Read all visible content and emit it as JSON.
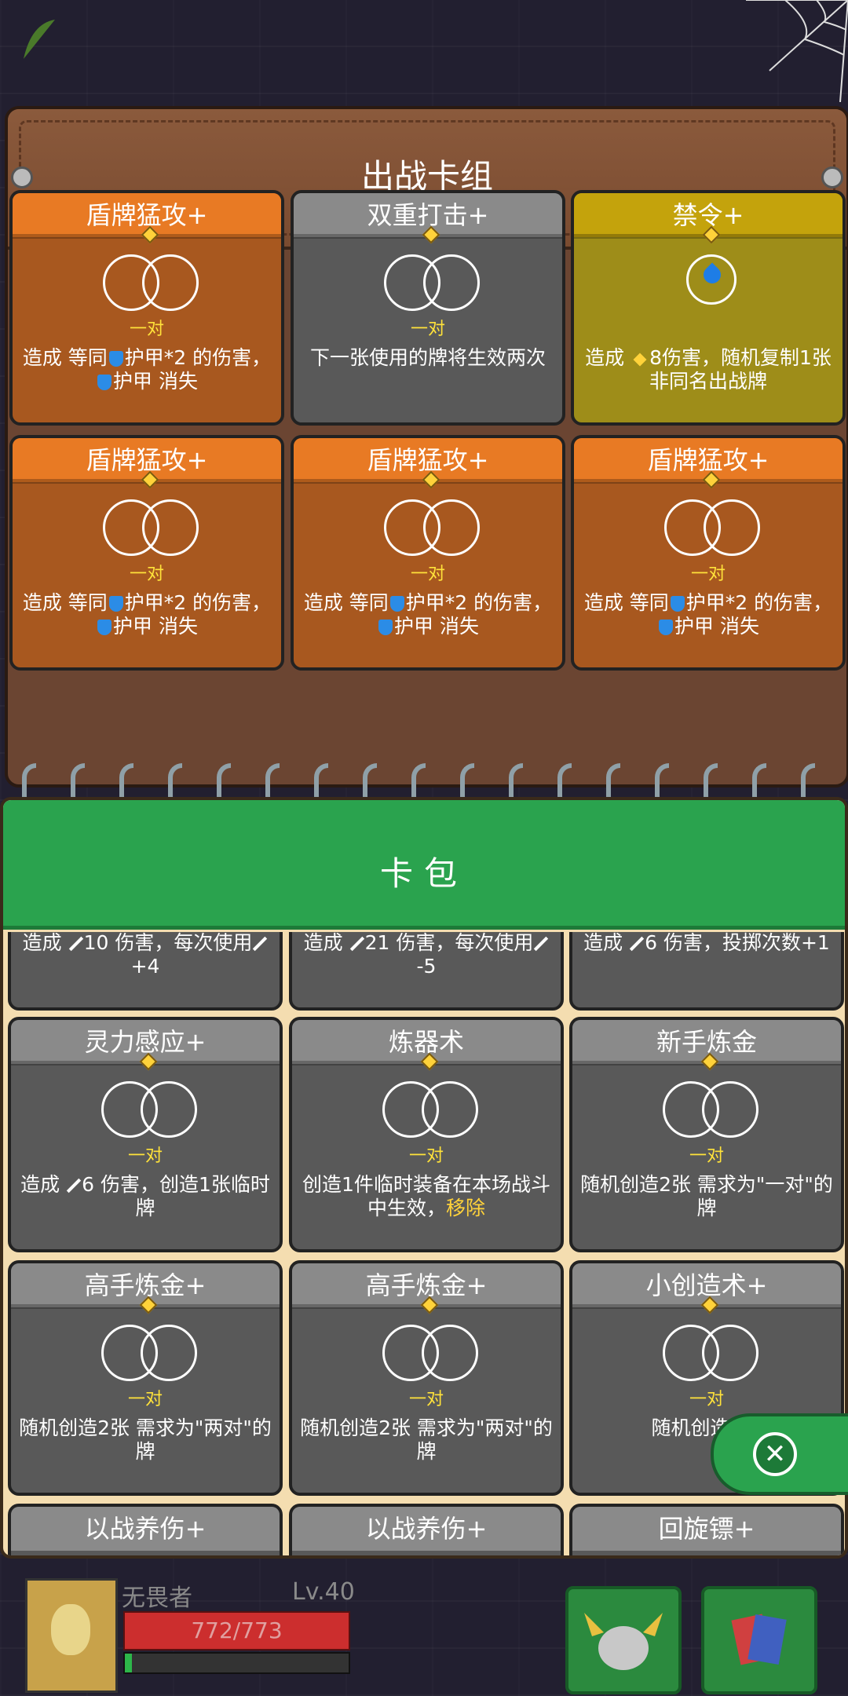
{
  "deck": {
    "title": "出战卡组",
    "cards": [
      {
        "name": "盾牌猛攻+",
        "theme": "orange",
        "icon": "rings",
        "pair": "一对",
        "desc": [
          "造成 等同",
          "shield",
          "护甲*2 的伤害，",
          "shield",
          "护甲 消失"
        ]
      },
      {
        "name": "双重打击+",
        "theme": "gray",
        "icon": "rings",
        "pair": "一对",
        "desc": [
          "下一张使用的牌将生效两次"
        ]
      },
      {
        "name": "禁令+",
        "theme": "olive",
        "icon": "drop",
        "pair": "",
        "desc": [
          "造成 ",
          "dia",
          "8",
          "伤害，随机复制1张非同名出战牌"
        ]
      },
      {
        "name": "盾牌猛攻+",
        "theme": "orange",
        "icon": "rings",
        "pair": "一对",
        "desc": [
          "造成 等同",
          "shield",
          "护甲*2 的伤害，",
          "shield",
          "护甲 消失"
        ]
      },
      {
        "name": "盾牌猛攻+",
        "theme": "orange",
        "icon": "rings",
        "pair": "一对",
        "desc": [
          "造成 等同",
          "shield",
          "护甲*2 的伤害，",
          "shield",
          "护甲 消失"
        ]
      },
      {
        "name": "盾牌猛攻+",
        "theme": "orange",
        "icon": "rings",
        "pair": "一对",
        "desc": [
          "造成 等同",
          "shield",
          "护甲*2 的伤害，",
          "shield",
          "护甲 消失"
        ]
      }
    ]
  },
  "pack": {
    "title": "卡包",
    "partial_top": [
      {
        "desc": [
          "造成 ",
          "sword",
          "10 伤害，每次使用",
          "sword",
          "+4"
        ]
      },
      {
        "desc": [
          "造成 ",
          "sword",
          "21 伤害，每次使用",
          "sword",
          "-5"
        ]
      },
      {
        "desc": [
          "造成 ",
          "sword",
          "6 伤害，投掷次数+1"
        ]
      }
    ],
    "cards": [
      {
        "name": "灵力感应+",
        "theme": "gray",
        "icon": "rings",
        "pair": "一对",
        "desc": [
          "造成 ",
          "sword",
          "6 伤害，创造1张临时牌"
        ]
      },
      {
        "name": "炼器术",
        "theme": "gray",
        "icon": "rings",
        "pair": "一对",
        "desc": [
          "创造1件临时装备在本场战斗中生效，",
          "hl:移除"
        ]
      },
      {
        "name": "新手炼金",
        "theme": "gray",
        "icon": "rings",
        "pair": "一对",
        "desc": [
          "随机创造2张 需求为\"一对\"的牌"
        ]
      },
      {
        "name": "高手炼金+",
        "theme": "gray",
        "icon": "rings",
        "pair": "一对",
        "desc": [
          "随机创造2张 需求为\"两对\"的牌"
        ]
      },
      {
        "name": "高手炼金+",
        "theme": "gray",
        "icon": "rings",
        "pair": "一对",
        "desc": [
          "随机创造2张 需求为\"两对\"的牌"
        ]
      },
      {
        "name": "小创造术+",
        "theme": "gray",
        "icon": "rings",
        "pair": "一对",
        "desc": [
          "随机创造2张"
        ]
      }
    ],
    "partial_bottom": [
      "以战养伤+",
      "以战养伤+",
      "回旋镖+"
    ]
  },
  "player": {
    "name": "无畏者",
    "level": "Lv.40",
    "hp_text": "772/773",
    "hp_fraction": 0.9987,
    "xp_fraction": 0.03
  }
}
